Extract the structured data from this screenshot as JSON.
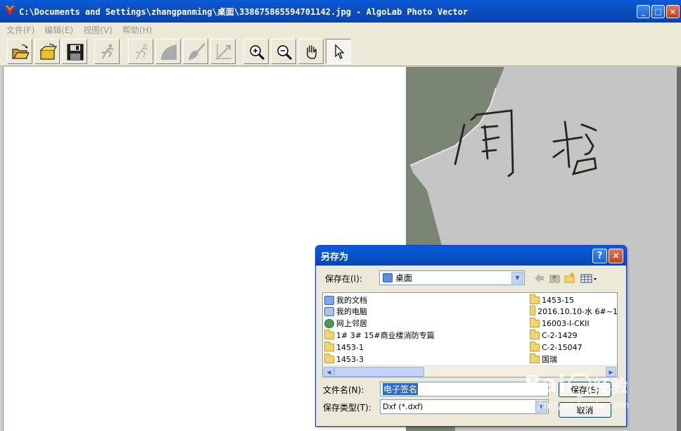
{
  "window": {
    "title": "C:\\Documents and Settings\\zhangpanming\\桌面\\338675865594701142.jpg - AlgoLab Photo Vector",
    "min_label": "_",
    "max_label": "□",
    "close_label": "×"
  },
  "menu": {
    "items": [
      {
        "label": "文件(F)"
      },
      {
        "label": "编辑(E)"
      },
      {
        "label": "视图(V)"
      },
      {
        "label": "帮助(H)"
      }
    ]
  },
  "toolbar": {
    "tools": [
      {
        "icon": "open-folder-icon",
        "enabled": true
      },
      {
        "icon": "open-image-icon",
        "enabled": true
      },
      {
        "icon": "save-disk-icon",
        "enabled": true
      },
      {
        "icon": "runner-icon",
        "enabled": false
      },
      {
        "icon": "runner-line-icon",
        "enabled": false
      },
      {
        "icon": "curve-shape-icon",
        "enabled": false
      },
      {
        "icon": "brush-icon",
        "enabled": false
      },
      {
        "icon": "vector-arrow-icon",
        "enabled": false
      },
      {
        "icon": "zoom-in-icon",
        "enabled": true
      },
      {
        "icon": "zoom-out-icon",
        "enabled": true
      },
      {
        "icon": "hand-pan-icon",
        "enabled": true
      },
      {
        "icon": "pointer-arrow-icon",
        "enabled": true,
        "pressed": true
      }
    ]
  },
  "image": {
    "handwriting": "闫哲"
  },
  "dialog": {
    "title": "另存为",
    "help_label": "?",
    "close_label": "×",
    "save_in_label": "保存在(I):",
    "save_in_value": "桌面",
    "files_left": [
      {
        "label": "我的文档",
        "icon": "my-documents-icon"
      },
      {
        "label": "我的电脑",
        "icon": "my-computer-icon"
      },
      {
        "label": "网上邻居",
        "icon": "network-places-icon"
      },
      {
        "label": "1# 3# 15#商业楼消防专篇",
        "icon": "folder-icon"
      },
      {
        "label": "1453-1",
        "icon": "folder-icon"
      },
      {
        "label": "1453-3",
        "icon": "folder-icon"
      }
    ],
    "files_right": [
      {
        "label": "1453-15",
        "icon": "folder-icon"
      },
      {
        "label": "2016.10.10-水 6#~1",
        "icon": "folder-icon"
      },
      {
        "label": "16003-I-CKII",
        "icon": "folder-icon"
      },
      {
        "label": "C-2-1429",
        "icon": "folder-icon"
      },
      {
        "label": "C-2-15047",
        "icon": "folder-icon"
      },
      {
        "label": "国瑞",
        "icon": "folder-icon"
      }
    ],
    "filename_label": "文件名(N):",
    "filename_value": "电子签名",
    "filetype_label": "保存类型(T):",
    "filetype_value": "Dxf (*.dxf)",
    "save_button": "保存(S)",
    "cancel_button": "取消"
  },
  "watermark": {
    "brand": "Bai",
    "brand2": "经验",
    "url": "jingyan.baidu.com"
  }
}
